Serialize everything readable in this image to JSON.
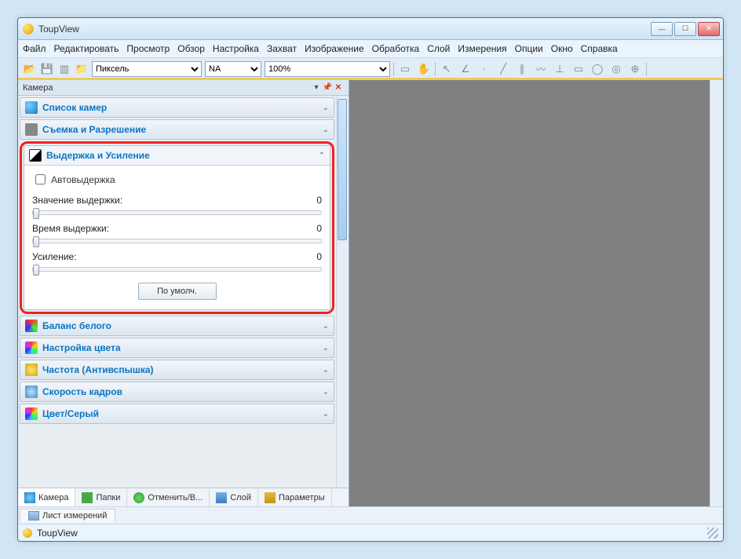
{
  "window": {
    "title": "ToupView"
  },
  "menu": [
    "Файл",
    "Редактировать",
    "Просмотр",
    "Обзор",
    "Настройка",
    "Захват",
    "Изображение",
    "Обработка",
    "Слой",
    "Измерения",
    "Опции",
    "Окно",
    "Справка"
  ],
  "toolbar": {
    "unit_selected": "Пиксель",
    "na_selected": "NA",
    "zoom_selected": "100%"
  },
  "side_panel": {
    "title": "Камера",
    "sections": {
      "camera_list": "Список камер",
      "capture_res": "Съемка и Разрешение",
      "exposure_gain": "Выдержка и Усиление",
      "white_balance": "Баланс белого",
      "color_adjust": "Настройка цвета",
      "freq": "Частота (Антивспышка)",
      "frame_rate": "Скорость кадров",
      "color_gray": "Цвет/Серый"
    },
    "exposure": {
      "auto_label": "Автовыдержка",
      "target_label": "Значение выдержки:",
      "target_value": "0",
      "time_label": "Время выдержки:",
      "time_value": "0",
      "gain_label": "Усиление:",
      "gain_value": "0",
      "default_btn": "По умолч."
    },
    "tabs": {
      "camera": "Камера",
      "folders": "Папки",
      "undo": "Отменить/В...",
      "layer": "Слой",
      "params": "Параметры"
    }
  },
  "sheet_tab": "Лист измерений",
  "statusbar": {
    "text": "ToupView"
  }
}
